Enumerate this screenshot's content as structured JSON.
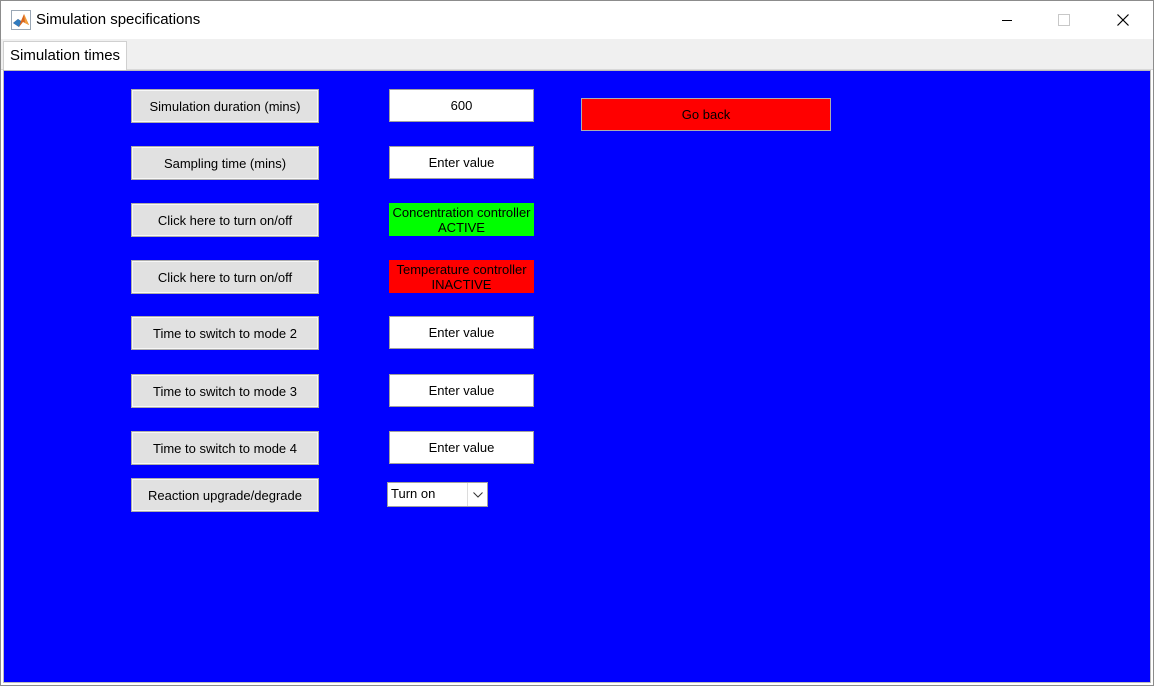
{
  "window": {
    "title": "Simulation specifications",
    "icon": "matlab-icon",
    "controls": [
      "minimize-icon",
      "maximize-icon",
      "close-icon"
    ]
  },
  "tabs": [
    {
      "label": "Simulation times",
      "selected": true
    }
  ],
  "panel": {
    "background_color": "#0000ff"
  },
  "rows": [
    {
      "button_label": "Simulation duration (mins)",
      "field_value": "600"
    },
    {
      "button_label": "Sampling time (mins)",
      "field_value": "Enter value"
    },
    {
      "button_label": "Click here to turn on/off",
      "status_line1": "Concentration controller",
      "status_line2": "ACTIVE",
      "status_color": "#00ff00"
    },
    {
      "button_label": "Click here to turn on/off",
      "status_line1": "Temperature controller",
      "status_line2": "INACTIVE",
      "status_color": "#ff0000"
    },
    {
      "button_label": "Time to switch to mode 2",
      "field_value": "Enter value"
    },
    {
      "button_label": "Time to switch to mode 3",
      "field_value": "Enter value"
    },
    {
      "button_label": "Time to switch to mode 4",
      "field_value": "Enter value"
    },
    {
      "button_label": "Reaction upgrade/degrade",
      "select_value": "Turn on"
    }
  ],
  "go_back": {
    "label": "Go back",
    "color": "#ff0000"
  }
}
